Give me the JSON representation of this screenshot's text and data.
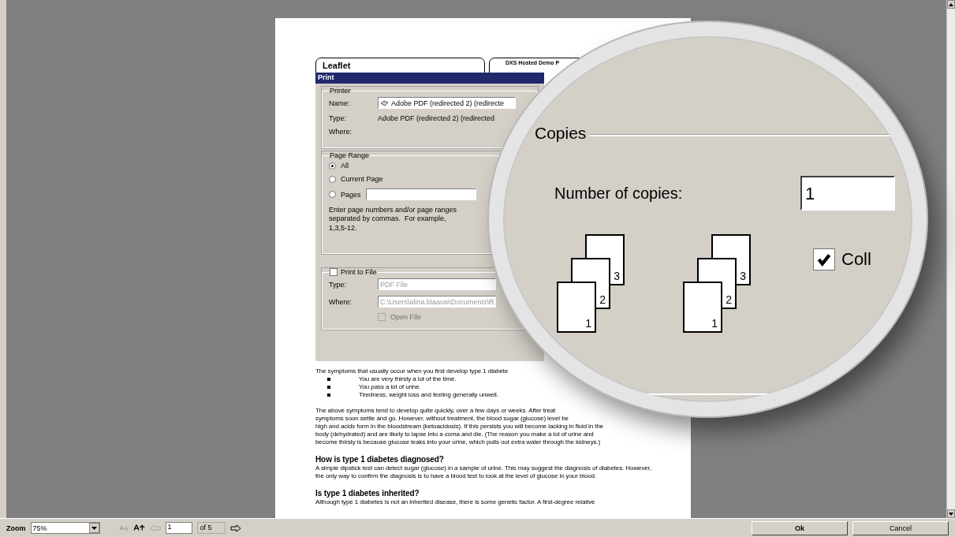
{
  "document": {
    "header_boxes": [
      "Leaflet",
      "DXS Hosted Demo P"
    ],
    "print_dialog": {
      "title": "Print",
      "printer": {
        "legend": "Printer",
        "name_label": "Name:",
        "name_value": "Adobe PDF (redirected 2) (redirecte",
        "type_label": "Type:",
        "type_value": "Adobe PDF (redirected 2) (redirected",
        "where_label": "Where:"
      },
      "page_range": {
        "legend": "Page Range",
        "options": [
          {
            "label": "All",
            "selected": true
          },
          {
            "label": "Current Page",
            "selected": false
          },
          {
            "label": "Pages",
            "selected": false
          }
        ],
        "hint": "Enter page numbers and/or page ranges separated by commas.  For example, 1,3,5-12."
      },
      "print_to_file": {
        "legend": "Print to File",
        "checked": false,
        "type_label": "Type:",
        "type_value": "PDF File",
        "where_label": "Where:",
        "where_value": "C:\\Users\\alina.blaauw\\Documents\\R",
        "open_file": {
          "label": "Open File",
          "checked": false,
          "disabled": true
        }
      }
    },
    "intro": "The symptoms that usually occur when you first develop type 1 diabete",
    "bullets": [
      "You are very thirsty a lot of the time.",
      "You pass a lot of urine.",
      "Tiredness, weight loss and feeling generally unwell."
    ],
    "paragraph_lines": [
      "The above symptoms tend to develop quite quickly, over a few days or weeks. After treat",
      "symptoms soon settle and go. However, without treatment, the blood sugar (glucose) level be",
      "high and acids form in the bloodstream (ketoacidosis). If this persists you will become lacking in fluid in the",
      "body (dehydrated) and are likely to lapse into a coma and die. (The reason you make a lot of urine and",
      "become thirsty is because glucose leaks into your urine, which pulls out extra water through the kidneys.)"
    ],
    "sections": [
      {
        "heading": "How is type 1 diabetes diagnosed?",
        "text": "A simple dipstick test can detect sugar (glucose) in a sample of urine. This may suggest the diagnosis of diabetes. However, the only way to confirm the diagnosis is to have a blood test to look at the level of glucose in your blood."
      },
      {
        "heading": "Is type 1 diabetes inherited?",
        "text": "Although type 1 diabetes is not an inherited disease, there is some genetic factor. A first-degree relative"
      }
    ]
  },
  "magnifier": {
    "legend": "Copies",
    "copies_label": "Number of copies:",
    "copies_value": "1",
    "stacks": [
      [
        "1",
        "2",
        "3"
      ],
      [
        "1",
        "2",
        "3"
      ]
    ],
    "collate": {
      "label": "Coll",
      "checked": true
    }
  },
  "toolbar": {
    "zoom_label": "Zoom",
    "zoom_value": "75%",
    "font_smaller": {
      "disabled": true
    },
    "font_larger": {
      "disabled": false
    },
    "previous": {
      "disabled": true
    },
    "page": "1",
    "page_count": "of 5",
    "next": {
      "disabled": false
    },
    "buttons": [
      {
        "label": "Ok",
        "default": true
      },
      {
        "label": "Cancel",
        "default": false
      }
    ]
  }
}
